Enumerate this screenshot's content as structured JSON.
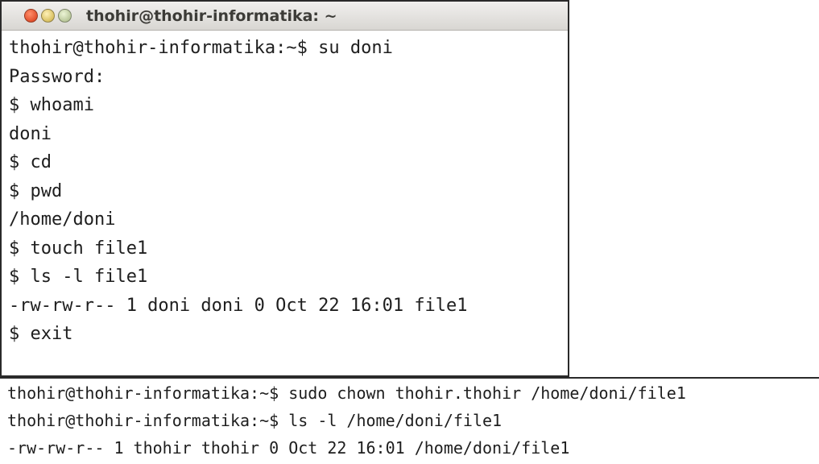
{
  "window1": {
    "title": "thohir@thohir-informatika: ~",
    "lines": [
      "thohir@thohir-informatika:~$ su doni",
      "Password:",
      "$ whoami",
      "doni",
      "$ cd",
      "$ pwd",
      "/home/doni",
      "$ touch file1",
      "$ ls -l file1",
      "-rw-rw-r-- 1 doni doni 0 Oct 22 16:01 file1",
      "$ exit"
    ]
  },
  "window2": {
    "lines": [
      "thohir@thohir-informatika:~$ sudo chown thohir.thohir /home/doni/file1",
      "thohir@thohir-informatika:~$ ls -l /home/doni/file1",
      "-rw-rw-r-- 1 thohir thohir 0 Oct 22 16:01 /home/doni/file1"
    ]
  }
}
